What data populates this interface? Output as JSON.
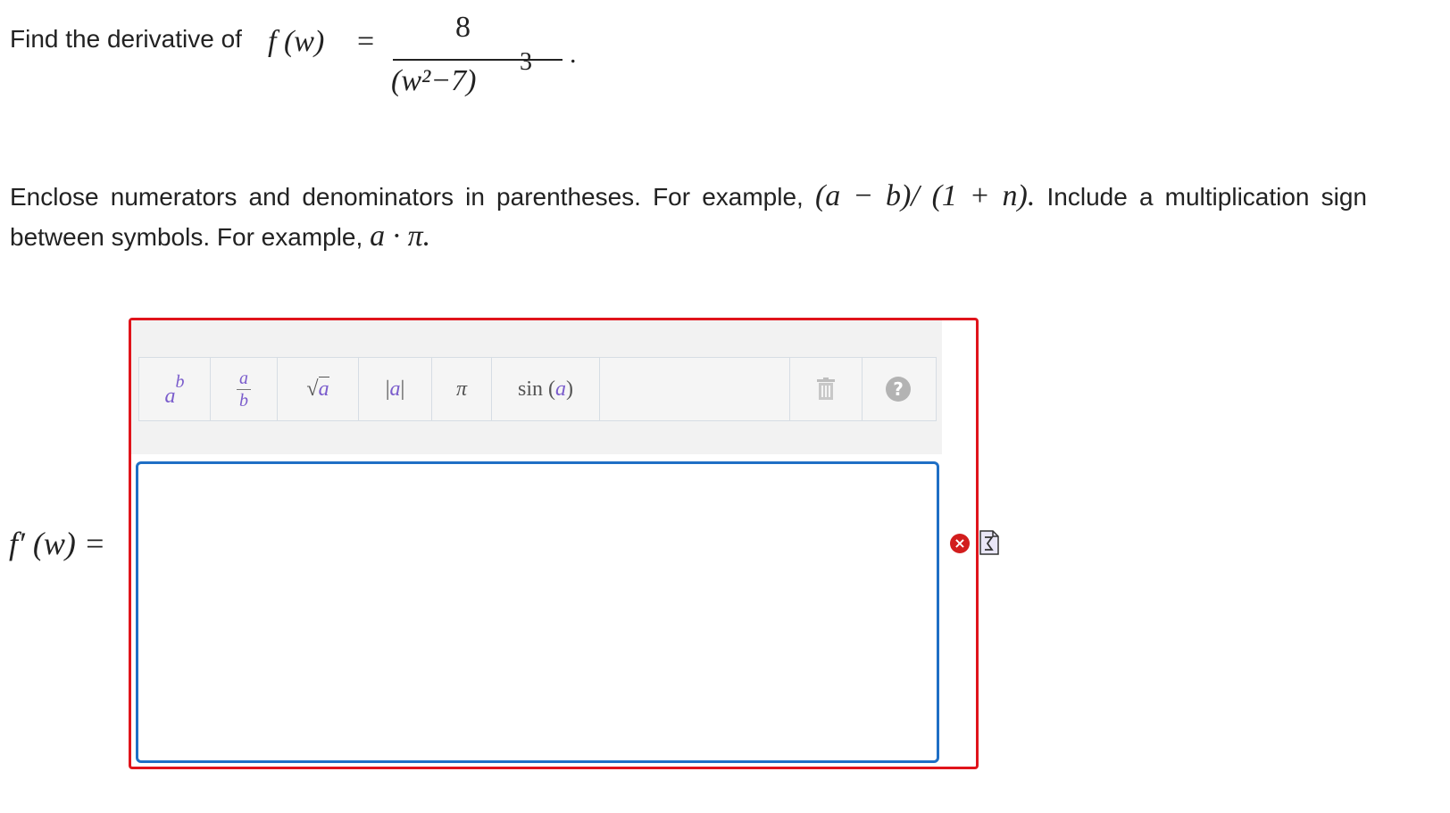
{
  "question": {
    "prefix": "Find the derivative of",
    "function_lhs": "f (w)",
    "equals": "=",
    "numerator": "8",
    "denominator_base": "(w²−7)",
    "denominator_exponent": "3",
    "period": "."
  },
  "instructions": {
    "part1": "Enclose numerators and denominators in parentheses. For example,",
    "example1": "(a − b)/ (1 + n).",
    "part2": "Include a multiplication sign between symbols. For example,",
    "example2": "a · π."
  },
  "answer": {
    "label": "f′ (w) ="
  },
  "toolbar": {
    "buttons": [
      {
        "name": "power",
        "label": "a^b"
      },
      {
        "name": "fraction",
        "label": "a/b"
      },
      {
        "name": "sqrt",
        "label": "√a"
      },
      {
        "name": "abs",
        "label": "|a|"
      },
      {
        "name": "pi",
        "label": "π"
      },
      {
        "name": "sin",
        "label": "sin (a)"
      }
    ],
    "icons": [
      "trash-icon",
      "help-icon"
    ]
  },
  "colors": {
    "error_border": "#e0141b",
    "editor_border": "#1f6fc5",
    "variable": "#7a5ccc"
  }
}
